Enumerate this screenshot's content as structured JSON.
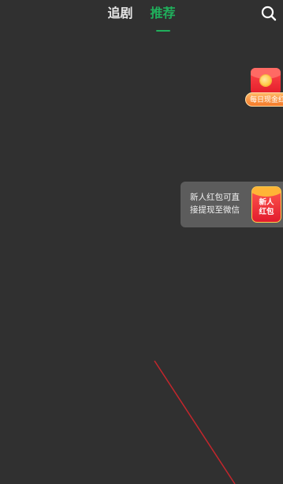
{
  "header": {
    "tabs": [
      {
        "label": "追剧",
        "active": false
      },
      {
        "label": "推荐",
        "active": true
      }
    ],
    "search_icon": "search-icon"
  },
  "daily_cash": {
    "label": "每日现金红包",
    "icon": "red-envelope-icon"
  },
  "promo": {
    "line1": "新人红包可直",
    "line2": "接提现至微信",
    "badge_line1": "新人",
    "badge_line2": "红包"
  },
  "colors": {
    "background": "#303030",
    "accent_green": "#20b05c",
    "promo_bg": "#5c5c5c",
    "red": "#e31c2a"
  }
}
